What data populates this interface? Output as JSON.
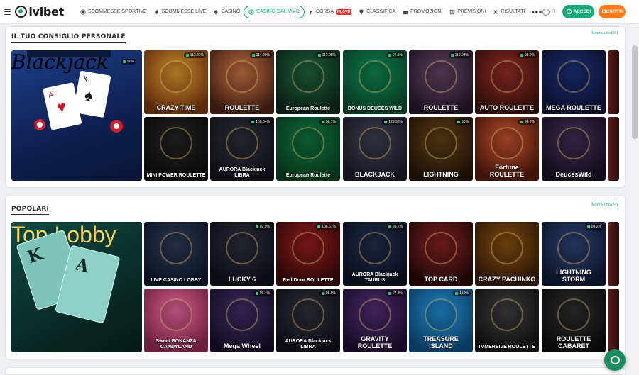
{
  "header": {
    "logo_text": "ivibet",
    "nav": [
      {
        "label": "SCOMMESSE SPORTIVE",
        "icon": "football-icon"
      },
      {
        "label": "SCOMMESSE LIVE",
        "icon": "flame-icon"
      },
      {
        "label": "CASINÒ",
        "icon": "spade-icon"
      },
      {
        "label": "CASINÒ DAL VIVO",
        "icon": "chip-icon",
        "active": true
      },
      {
        "label": "CORSA",
        "icon": "horse-icon",
        "badge": "NUOVO"
      },
      {
        "label": "CLASSIFICA",
        "icon": "trophy-icon"
      },
      {
        "label": "PROMOZIONI",
        "icon": "gift-icon"
      },
      {
        "label": "PREVISIONI",
        "icon": "chart-icon"
      },
      {
        "label": "RISULTATI",
        "icon": "results-icon"
      }
    ],
    "more": "•••",
    "lang": "IT",
    "login": "ACCEDI",
    "register": "ISCRIVITI",
    "accent": "#19a877",
    "register_color": "#ff7a1a"
  },
  "sections": [
    {
      "title": "IL TUO CONSIGLIO PERSONALE",
      "show_all": "Mostra tutto (50)",
      "featured": {
        "name": "Blackjack",
        "rtp": "90%"
      },
      "tiles": [
        {
          "name": "CRAZY TIME",
          "rtp": "112.21%"
        },
        {
          "name": "ROULETTE",
          "rtp": "114.29%"
        },
        {
          "name": "European Roulette",
          "rtp": "112.08%"
        },
        {
          "name": "BONUS DEUCES WILD",
          "rtp": "92.5%"
        },
        {
          "name": "ROULETTE",
          "rtp": "112.93%"
        },
        {
          "name": "AUTO ROULETTE",
          "rtp": "98.6%"
        },
        {
          "name": "MEGA ROULETTE",
          "rtp": ""
        },
        {
          "name": "MINI POWER ROULETTE",
          "rtp": ""
        },
        {
          "name": "AURORA Blackjack LIBRA",
          "rtp": "100.04%"
        },
        {
          "name": "European Roulette",
          "rtp": "98.1%"
        },
        {
          "name": "BLACKJACK",
          "rtp": "123.38%"
        },
        {
          "name": "LIGHTNING",
          "rtp": "90%"
        },
        {
          "name": "Fortune ROULETTE",
          "rtp": "96.2%"
        },
        {
          "name": "DeucesWild",
          "rtp": ""
        }
      ]
    },
    {
      "title": "POPOLARI",
      "show_all": "Mostra tutto (74)",
      "featured": {
        "name": "Top Lobby",
        "rtp": ""
      },
      "tiles": [
        {
          "name": "LIVE CASINO LOBBY",
          "rtp": ""
        },
        {
          "name": "LUCKY 6",
          "rtp": "92.9%"
        },
        {
          "name": "Red Door ROULETTE",
          "rtp": "106.67%"
        },
        {
          "name": "AURORA Blackjack TAURUS",
          "rtp": "93.2%"
        },
        {
          "name": "TOP CARD",
          "rtp": ""
        },
        {
          "name": "CRAZY PACHINKO",
          "rtp": ""
        },
        {
          "name": "LIGHTNING STORM",
          "rtp": "99.2%"
        },
        {
          "name": "Sweet BONANZA CANDYLAND",
          "rtp": ""
        },
        {
          "name": "Mega Wheel",
          "rtp": "96.4%"
        },
        {
          "name": "AURORA Blackjack LIBRA",
          "rtp": "98.9%"
        },
        {
          "name": "GRAVITY ROULETTE",
          "rtp": "97.8%"
        },
        {
          "name": "TREASURE ISLAND",
          "rtp": "150%"
        },
        {
          "name": "IMMERSIVE ROULETTE",
          "rtp": ""
        },
        {
          "name": "ROULETTE CABARET",
          "rtp": ""
        }
      ]
    }
  ]
}
